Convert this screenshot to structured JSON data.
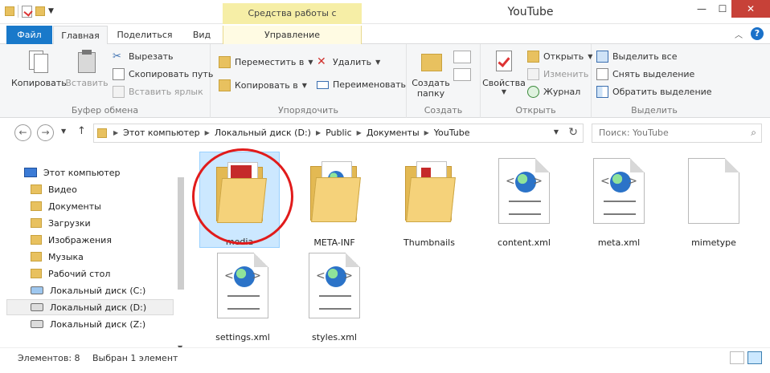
{
  "window": {
    "title": "YouTube",
    "context_tab_group": "Средства работы с рисунками"
  },
  "tabs": {
    "file": "Файл",
    "home": "Главная",
    "share": "Поделиться",
    "view": "Вид",
    "manage": "Управление"
  },
  "ribbon": {
    "clipboard": {
      "label": "Буфер обмена",
      "copy": "Копировать",
      "paste": "Вставить",
      "cut": "Вырезать",
      "copy_path": "Скопировать путь",
      "paste_shortcut": "Вставить ярлык"
    },
    "organize": {
      "label": "Упорядочить",
      "move_to": "Переместить в",
      "copy_to": "Копировать в",
      "delete": "Удалить",
      "rename": "Переименовать"
    },
    "new": {
      "label": "Создать",
      "new_folder_line1": "Создать",
      "new_folder_line2": "папку"
    },
    "open": {
      "label": "Открыть",
      "properties": "Свойства",
      "open": "Открыть",
      "edit": "Изменить",
      "history": "Журнал"
    },
    "select": {
      "label": "Выделить",
      "select_all": "Выделить все",
      "select_none": "Снять выделение",
      "invert": "Обратить выделение"
    }
  },
  "address": {
    "crumbs": [
      "Этот компьютер",
      "Локальный диск (D:)",
      "Public",
      "Документы",
      "YouTube"
    ],
    "search_placeholder": "Поиск: YouTube"
  },
  "nav": {
    "items": [
      {
        "label": "Этот компьютер",
        "icon": "computer-icon"
      },
      {
        "label": "Видео",
        "icon": "folder-icon"
      },
      {
        "label": "Документы",
        "icon": "folder-icon"
      },
      {
        "label": "Загрузки",
        "icon": "folder-icon"
      },
      {
        "label": "Изображения",
        "icon": "folder-icon"
      },
      {
        "label": "Музыка",
        "icon": "folder-icon"
      },
      {
        "label": "Рабочий стол",
        "icon": "folder-icon"
      },
      {
        "label": "Локальный диск (C:)",
        "icon": "drive-icon"
      },
      {
        "label": "Локальный диск (D:)",
        "icon": "drive-icon",
        "selected": true
      },
      {
        "label": "Локальный диск (Z:)",
        "icon": "drive-icon"
      }
    ]
  },
  "files": [
    {
      "name": "media",
      "type": "folder",
      "selected": true
    },
    {
      "name": "META-INF",
      "type": "folder"
    },
    {
      "name": "Thumbnails",
      "type": "folder"
    },
    {
      "name": "content.xml",
      "type": "xml"
    },
    {
      "name": "meta.xml",
      "type": "xml"
    },
    {
      "name": "mimetype",
      "type": "file"
    },
    {
      "name": "settings.xml",
      "type": "xml"
    },
    {
      "name": "styles.xml",
      "type": "xml"
    }
  ],
  "status": {
    "count": "Элементов: 8",
    "selection": "Выбран 1 элемент"
  },
  "colors": {
    "file_tab": "#1979ca",
    "context_tab": "#f6eea6",
    "selection": "#cce8ff",
    "close": "#c74138",
    "highlight_circle": "#e11b1b"
  }
}
